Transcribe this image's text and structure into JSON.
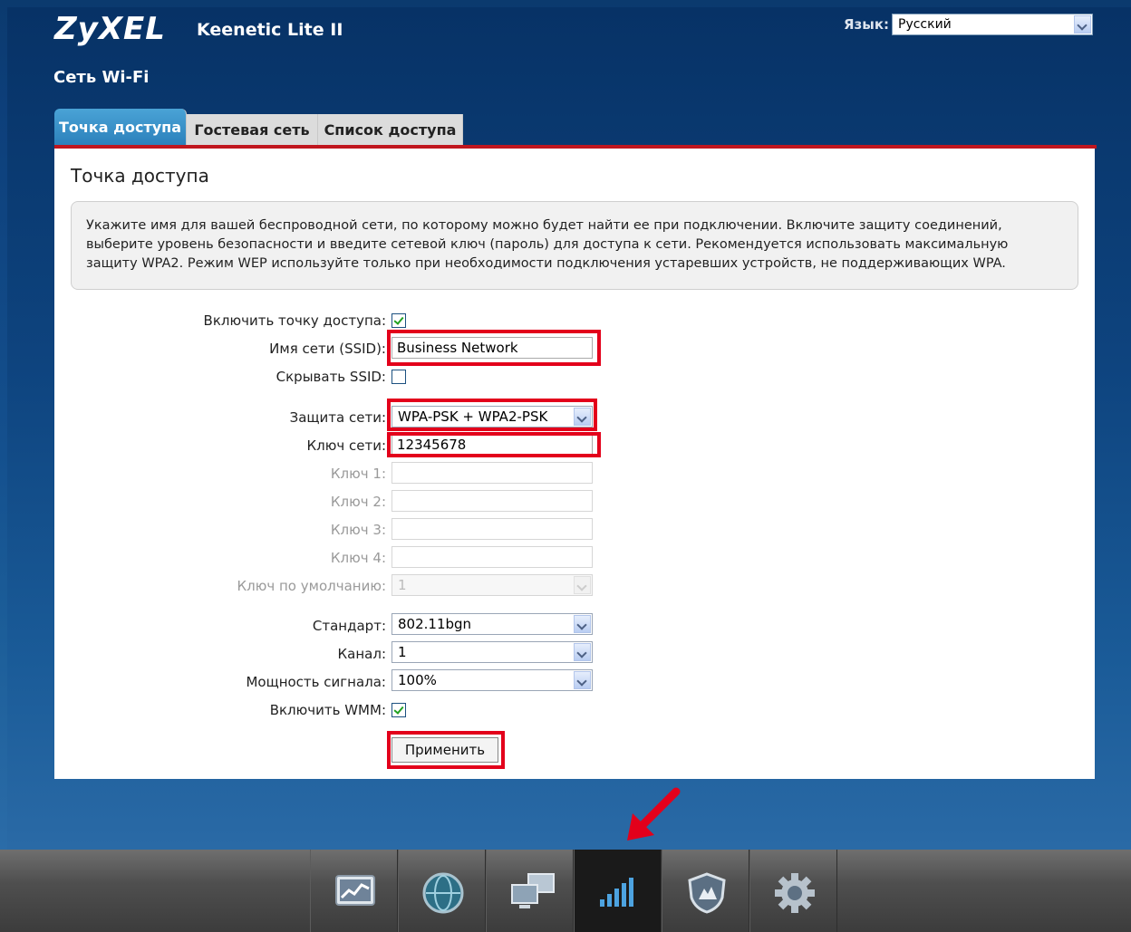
{
  "brand": {
    "logo": "ZyXEL",
    "model": "Keenetic Lite II"
  },
  "header": {
    "section_title": "Сеть Wi-Fi",
    "language_label": "Язык:",
    "language_value": "Русский"
  },
  "tabs": [
    {
      "label": "Точка доступа",
      "active": true
    },
    {
      "label": "Гостевая сеть",
      "active": false
    },
    {
      "label": "Список доступа",
      "active": false
    }
  ],
  "panel": {
    "title": "Точка доступа",
    "info": "Укажите имя для вашей беспроводной сети, по которому можно будет найти ее при подключении. Включите защиту соединений, выберите уровень безопасности и введите сетевой ключ (пароль) для доступа к сети. Рекомендуется использовать максимальную защиту WPA2. Режим WEP используйте только при необходимости подключения устаревших устройств, не поддерживающих WPA."
  },
  "form": {
    "enable_ap": {
      "label": "Включить точку доступа:",
      "checked": true
    },
    "ssid": {
      "label": "Имя сети (SSID):",
      "value": "Business Network"
    },
    "hide_ssid": {
      "label": "Скрывать SSID:",
      "checked": false
    },
    "security": {
      "label": "Защита сети:",
      "value": "WPA-PSK + WPA2-PSK"
    },
    "network_key": {
      "label": "Ключ сети:",
      "value": "12345678"
    },
    "key1": {
      "label": "Ключ 1:"
    },
    "key2": {
      "label": "Ключ 2:"
    },
    "key3": {
      "label": "Ключ 3:"
    },
    "key4": {
      "label": "Ключ 4:"
    },
    "default_key": {
      "label": "Ключ по умолчанию:",
      "value": "1"
    },
    "standard": {
      "label": "Стандарт:",
      "value": "802.11bgn"
    },
    "channel": {
      "label": "Канал:",
      "value": "1"
    },
    "power": {
      "label": "Мощность сигнала:",
      "value": "100%"
    },
    "wmm": {
      "label": "Включить WMM:",
      "checked": true
    },
    "apply_label": "Применить"
  },
  "nav_icons": [
    "monitor-chart-icon",
    "globe-icon",
    "computers-icon",
    "wifi-signal-icon",
    "shield-icon",
    "gear-icon"
  ],
  "colors": {
    "highlight": "#e3001b",
    "tab_active": "#2a7fba",
    "accent_line": "#c0161e"
  }
}
